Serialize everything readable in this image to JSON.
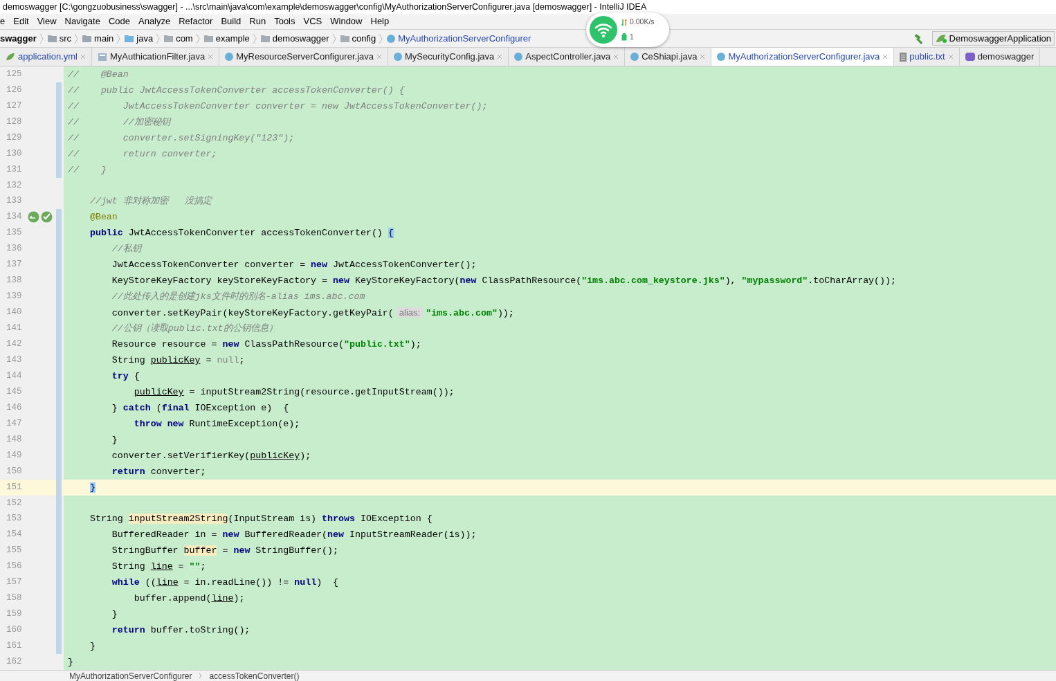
{
  "window": {
    "title": "demoswagger [C:\\gongzuobusiness\\swagger] - ...\\src\\main\\java\\com\\example\\demoswagger\\config\\MyAuthorizationServerConfigurer.java [demoswagger] - IntelliJ IDEA"
  },
  "menu": [
    "e",
    "Edit",
    "View",
    "Navigate",
    "Code",
    "Analyze",
    "Refactor",
    "Build",
    "Run",
    "Tools",
    "VCS",
    "Window",
    "Help"
  ],
  "breadcrumbs": [
    {
      "label": "swagger",
      "kind": "project"
    },
    {
      "label": "src",
      "kind": "folder"
    },
    {
      "label": "main",
      "kind": "folder"
    },
    {
      "label": "java",
      "kind": "source"
    },
    {
      "label": "com",
      "kind": "package"
    },
    {
      "label": "example",
      "kind": "package"
    },
    {
      "label": "demoswagger",
      "kind": "package"
    },
    {
      "label": "config",
      "kind": "package"
    },
    {
      "label": "MyAuthorizationServerConfigurer",
      "kind": "class"
    }
  ],
  "run_config": "DemoswaggerApplication",
  "network_widget": {
    "speed": "0.00K/s",
    "count": "1"
  },
  "tabs": [
    {
      "label": "application.yml",
      "kind": "yml",
      "selected": false,
      "modified": true
    },
    {
      "label": "MyAuthicationFilter.java",
      "kind": "filter",
      "selected": false,
      "modified": false
    },
    {
      "label": "MyResourceServerConfigurer.java",
      "kind": "class",
      "selected": false,
      "modified": false
    },
    {
      "label": "MySecurityConfig.java",
      "kind": "class",
      "selected": false,
      "modified": false
    },
    {
      "label": "AspectController.java",
      "kind": "class",
      "selected": false,
      "modified": false
    },
    {
      "label": "CeShiapi.java",
      "kind": "class",
      "selected": false,
      "modified": false
    },
    {
      "label": "MyAuthorizationServerConfigurer.java",
      "kind": "class",
      "selected": true,
      "modified": true
    },
    {
      "label": "public.txt",
      "kind": "text",
      "selected": false,
      "modified": true
    },
    {
      "label": "demoswagger",
      "kind": "maven",
      "selected": false,
      "modified": false
    }
  ],
  "lines": [
    {
      "n": "125",
      "changed": false,
      "t": [
        {
          "kind": "comment",
          "text": "//    @Bean"
        }
      ]
    },
    {
      "n": "126",
      "changed": true,
      "t": [
        {
          "kind": "comment",
          "text": "//    public JwtAccessTokenConverter accessTokenConverter() {"
        }
      ]
    },
    {
      "n": "127",
      "changed": true,
      "t": [
        {
          "kind": "comment",
          "text": "//        JwtAccessTokenConverter converter = new JwtAccessTokenConverter();"
        }
      ]
    },
    {
      "n": "128",
      "changed": true,
      "t": [
        {
          "kind": "comment",
          "text": "//        //加密秘钥"
        }
      ]
    },
    {
      "n": "129",
      "changed": true,
      "t": [
        {
          "kind": "comment",
          "text": "//        converter.setSigningKey(\"123\");"
        }
      ]
    },
    {
      "n": "130",
      "changed": true,
      "t": [
        {
          "kind": "comment",
          "text": "//        return converter;"
        }
      ]
    },
    {
      "n": "131",
      "changed": true,
      "t": [
        {
          "kind": "comment",
          "text": "//    }"
        }
      ]
    },
    {
      "n": "132",
      "changed": false
    },
    {
      "n": "133",
      "changed": false,
      "t": [
        {
          "kind": "comment",
          "text": "    //jwt 非对称加密   没搞定"
        }
      ]
    },
    {
      "n": "134",
      "changed": true,
      "gutter_icons": true,
      "t": [
        {
          "kind": "annotation",
          "text": "    @Bean"
        }
      ]
    },
    {
      "n": "135",
      "changed": true,
      "t": [
        {
          "kind": "keyword",
          "text": "    public"
        },
        {
          "kind": "plain",
          "text": " JwtAccessTokenConverter accessTokenConverter() "
        },
        {
          "kind": "brace_match",
          "text": "{"
        }
      ]
    },
    {
      "n": "136",
      "changed": true,
      "t": [
        {
          "kind": "comment",
          "text": "        //私钥"
        }
      ]
    },
    {
      "n": "137",
      "changed": true,
      "t": [
        {
          "kind": "plain",
          "text": "        JwtAccessTokenConverter converter = "
        },
        {
          "kind": "keyword",
          "text": "new"
        },
        {
          "kind": "plain",
          "text": " JwtAccessTokenConverter();"
        }
      ]
    },
    {
      "n": "138",
      "changed": true,
      "t": [
        {
          "kind": "plain",
          "text": "        KeyStoreKeyFactory keyStoreKeyFactory = "
        },
        {
          "kind": "keyword",
          "text": "new"
        },
        {
          "kind": "plain",
          "text": " KeyStoreKeyFactory("
        },
        {
          "kind": "keyword",
          "text": "new"
        },
        {
          "kind": "plain",
          "text": " ClassPathResource("
        },
        {
          "kind": "string",
          "text": "\"ims.abc.com_keystore.jks\""
        },
        {
          "kind": "plain",
          "text": "), "
        },
        {
          "kind": "string",
          "text": "\"mypassword\""
        },
        {
          "kind": "plain",
          "text": ".toCharArray());"
        }
      ]
    },
    {
      "n": "139",
      "changed": true,
      "t": [
        {
          "kind": "comment",
          "text": "        //此处传入的是创建jks文件时的别名-alias ims.abc.com"
        }
      ]
    },
    {
      "n": "140",
      "changed": true,
      "t": [
        {
          "kind": "plain",
          "text": "        converter.setKeyPair(keyStoreKeyFactory.getKeyPair("
        },
        {
          "kind": "hint",
          "text": "alias:"
        },
        {
          "kind": "string",
          "text": "\"ims.abc.com\""
        },
        {
          "kind": "plain",
          "text": "));"
        }
      ]
    },
    {
      "n": "141",
      "changed": true,
      "t": [
        {
          "kind": "comment",
          "text": "        //公钥（读取public.txt的公钥信息）"
        }
      ]
    },
    {
      "n": "142",
      "changed": true,
      "t": [
        {
          "kind": "plain",
          "text": "        Resource resource = "
        },
        {
          "kind": "keyword",
          "text": "new"
        },
        {
          "kind": "plain",
          "text": " ClassPathResource("
        },
        {
          "kind": "string",
          "text": "\"public.txt\""
        },
        {
          "kind": "plain",
          "text": ");"
        }
      ]
    },
    {
      "n": "143",
      "changed": true,
      "t": [
        {
          "kind": "plain",
          "text": "        String "
        },
        {
          "kind": "reassigned",
          "text": "publicKey"
        },
        {
          "kind": "plain",
          "text": " = "
        },
        {
          "kind": "unused",
          "text": "null"
        },
        {
          "kind": "plain",
          "text": ";"
        }
      ]
    },
    {
      "n": "144",
      "changed": true,
      "t": [
        {
          "kind": "keyword",
          "text": "        try"
        },
        {
          "kind": "plain",
          "text": " {"
        }
      ]
    },
    {
      "n": "145",
      "changed": true,
      "t": [
        {
          "kind": "reassigned",
          "text": "            publicKey"
        },
        {
          "kind": "plain",
          "text": " = inputStream2String(resource.getInputStream());"
        }
      ]
    },
    {
      "n": "146",
      "changed": true,
      "t": [
        {
          "kind": "plain",
          "text": "        } "
        },
        {
          "kind": "keyword",
          "text": "catch"
        },
        {
          "kind": "plain",
          "text": " ("
        },
        {
          "kind": "keyword",
          "text": "final"
        },
        {
          "kind": "plain",
          "text": " IOException e)  {"
        }
      ]
    },
    {
      "n": "147",
      "changed": true,
      "t": [
        {
          "kind": "keyword",
          "text": "            throw new"
        },
        {
          "kind": "plain",
          "text": " RuntimeException(e);"
        }
      ]
    },
    {
      "n": "148",
      "changed": true,
      "t": [
        {
          "kind": "plain",
          "text": "        }"
        }
      ]
    },
    {
      "n": "149",
      "changed": true,
      "t": [
        {
          "kind": "plain",
          "text": "        converter.setVerifierKey("
        },
        {
          "kind": "reassigned",
          "text": "publicKey"
        },
        {
          "kind": "plain",
          "text": ");"
        }
      ]
    },
    {
      "n": "150",
      "changed": true,
      "t": [
        {
          "kind": "keyword",
          "text": "        return"
        },
        {
          "kind": "plain",
          "text": " converter;"
        }
      ]
    },
    {
      "n": "151",
      "changed": true,
      "current": true,
      "t": [
        {
          "kind": "brace_match",
          "text": "    }"
        }
      ]
    },
    {
      "n": "152",
      "changed": true
    },
    {
      "n": "153",
      "changed": true,
      "t": [
        {
          "kind": "plain",
          "text": "    String "
        },
        {
          "kind": "highlight",
          "text": "inputStream2String"
        },
        {
          "kind": "plain",
          "text": "(InputStream is) "
        },
        {
          "kind": "keyword",
          "text": "throws"
        },
        {
          "kind": "plain",
          "text": " IOException {"
        }
      ]
    },
    {
      "n": "154",
      "changed": true,
      "t": [
        {
          "kind": "plain",
          "text": "        BufferedReader in = "
        },
        {
          "kind": "keyword",
          "text": "new"
        },
        {
          "kind": "plain",
          "text": " BufferedReader("
        },
        {
          "kind": "keyword",
          "text": "new"
        },
        {
          "kind": "plain",
          "text": " InputStreamReader(is));"
        }
      ]
    },
    {
      "n": "155",
      "changed": true,
      "t": [
        {
          "kind": "plain",
          "text": "        StringBuffer "
        },
        {
          "kind": "highlight",
          "text": "buffer"
        },
        {
          "kind": "plain",
          "text": " = "
        },
        {
          "kind": "keyword",
          "text": "new"
        },
        {
          "kind": "plain",
          "text": " StringBuffer();"
        }
      ]
    },
    {
      "n": "156",
      "changed": true,
      "t": [
        {
          "kind": "plain",
          "text": "        String "
        },
        {
          "kind": "reassigned",
          "text": "line"
        },
        {
          "kind": "plain",
          "text": " = "
        },
        {
          "kind": "string",
          "text": "\"\""
        },
        {
          "kind": "plain",
          "text": ";"
        }
      ]
    },
    {
      "n": "157",
      "changed": true,
      "t": [
        {
          "kind": "keyword",
          "text": "        while"
        },
        {
          "kind": "plain",
          "text": " (("
        },
        {
          "kind": "reassigned",
          "text": "line"
        },
        {
          "kind": "plain",
          "text": " = in.readLine()) != "
        },
        {
          "kind": "keyword",
          "text": "null"
        },
        {
          "kind": "plain",
          "text": ")  {"
        }
      ]
    },
    {
      "n": "158",
      "changed": true,
      "t": [
        {
          "kind": "plain",
          "text": "            buffer.append("
        },
        {
          "kind": "reassigned",
          "text": "line"
        },
        {
          "kind": "plain",
          "text": ");"
        }
      ]
    },
    {
      "n": "159",
      "changed": true,
      "t": [
        {
          "kind": "plain",
          "text": "        }"
        }
      ]
    },
    {
      "n": "160",
      "changed": true,
      "t": [
        {
          "kind": "keyword",
          "text": "        return"
        },
        {
          "kind": "plain",
          "text": " buffer.toString();"
        }
      ]
    },
    {
      "n": "161",
      "changed": true,
      "t": [
        {
          "kind": "plain",
          "text": "    }"
        }
      ]
    },
    {
      "n": "162",
      "changed": false,
      "t": [
        {
          "kind": "plain",
          "text": "}"
        }
      ]
    }
  ],
  "status_breadcrumbs": [
    "MyAuthorizationServerConfigurer",
    "accessTokenConverter()"
  ]
}
